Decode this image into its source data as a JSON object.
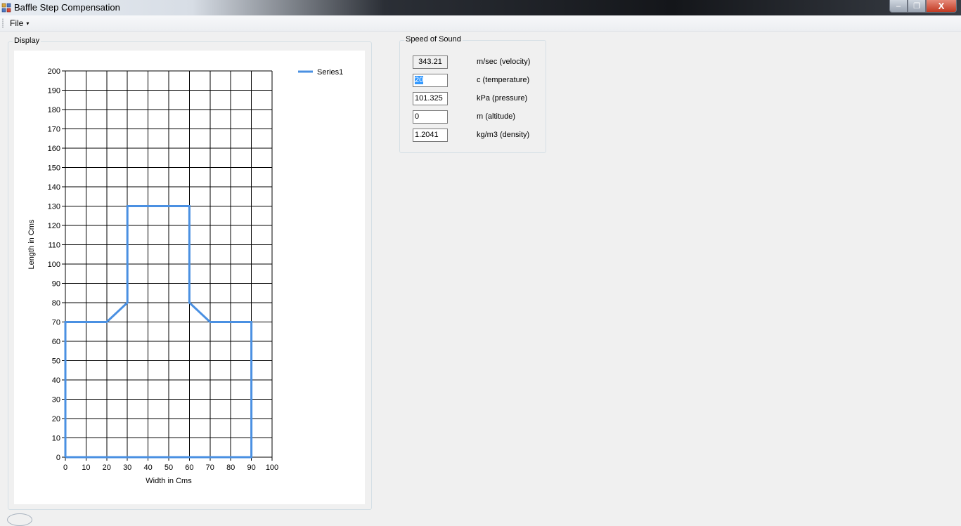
{
  "window": {
    "title": "Baffle Step Compensation",
    "minimize_label": "–",
    "maximize_label": "❐",
    "close_label": "X"
  },
  "menu": {
    "file_label": "File",
    "file_caret": "▾"
  },
  "display_group": {
    "title": "Display"
  },
  "speed_of_sound": {
    "title": "Speed of Sound",
    "rows": [
      {
        "value": "343.21",
        "label": "m/sec (velocity)"
      },
      {
        "value": "20",
        "label": "c (temperature)"
      },
      {
        "value": "101.325",
        "label": "kPa (pressure)"
      },
      {
        "value": "0",
        "label": "m (altitude)"
      },
      {
        "value": "1.2041",
        "label": "kg/m3 (density)"
      }
    ]
  },
  "chart_data": {
    "type": "line",
    "title": "",
    "xlabel": "Width in Cms",
    "ylabel": "Length in Cms",
    "xlim": [
      0,
      100
    ],
    "ylim": [
      0,
      200
    ],
    "x_ticks": [
      0,
      10,
      20,
      30,
      40,
      50,
      60,
      70,
      80,
      90,
      100
    ],
    "y_ticks": [
      0,
      10,
      20,
      30,
      40,
      50,
      60,
      70,
      80,
      90,
      100,
      110,
      120,
      130,
      140,
      150,
      160,
      170,
      180,
      190,
      200
    ],
    "grid": true,
    "legend_position": "top-right",
    "series": [
      {
        "name": "Series1",
        "color": "#4a90e2",
        "points": [
          [
            0,
            0
          ],
          [
            0,
            70
          ],
          [
            20,
            70
          ],
          [
            30,
            80
          ],
          [
            30,
            130
          ],
          [
            60,
            130
          ],
          [
            60,
            80
          ],
          [
            70,
            70
          ],
          [
            90,
            70
          ],
          [
            90,
            0
          ],
          [
            0,
            0
          ]
        ]
      }
    ]
  }
}
